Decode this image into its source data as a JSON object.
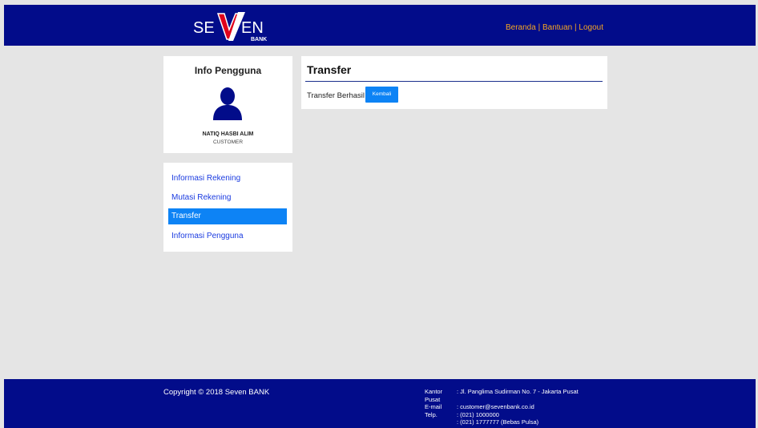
{
  "brand": {
    "name": "SEVEN BANK",
    "logo_text_left": "SE",
    "logo_text_right": "EN",
    "logo_sub": "BANK",
    "colors": {
      "navy": "#020c8a",
      "accent": "#f5a623",
      "red": "#e0001b",
      "blue": "#0d83f5"
    }
  },
  "topnav": {
    "beranda": "Beranda",
    "bantuan": "Bantuan",
    "logout": "Logout",
    "separator": "|"
  },
  "user": {
    "title": "Info Pengguna",
    "avatar_icon": "user-silhouette-icon",
    "name": "NATIQ HASBI ALIM",
    "role": "CUSTOMER"
  },
  "menu": {
    "items": [
      {
        "label": "Informasi Rekening",
        "active": false
      },
      {
        "label": "Mutasi Rekening",
        "active": false
      },
      {
        "label": "Transfer",
        "active": true
      },
      {
        "label": "Informasi Pengguna",
        "active": false
      }
    ]
  },
  "main": {
    "title": "Transfer",
    "status": "Transfer Berhasil",
    "back_label": "Kembali"
  },
  "footer": {
    "copyright": "Copyright © 2018 Seven BANK",
    "contact": [
      {
        "k": "Kantor Pusat",
        "v": ": Jl. Panglima Sudirman No. 7 - Jakarta Pusat"
      },
      {
        "k": "E-mail",
        "v": ": customer@sevenbank.co.id"
      },
      {
        "k": "Telp.",
        "v": ": (021) 1000000"
      },
      {
        "k": "",
        "v": ": (021) 1777777 (Bebas Pulsa)"
      }
    ]
  }
}
